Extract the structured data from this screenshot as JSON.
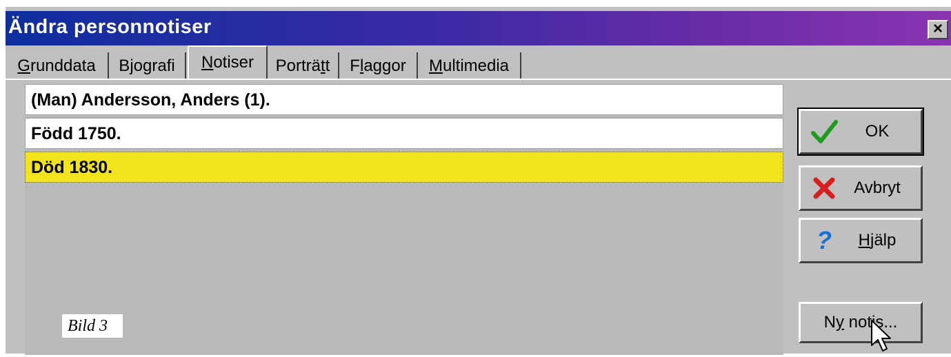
{
  "window": {
    "title": "Ändra personnotiser",
    "close_glyph": "×"
  },
  "tabs": [
    {
      "label_ul": "G",
      "label_rest": "runddata"
    },
    {
      "label_pre": "B",
      "label_ul": "j",
      "label_rest": "ografi"
    },
    {
      "label_ul": "N",
      "label_rest": "otiser"
    },
    {
      "label_pre": "Port",
      "label_mid": "rä",
      "label_ul": "t",
      "label_rest": "t"
    },
    {
      "label_pre": "F",
      "label_ul": "l",
      "label_rest": "aggor"
    },
    {
      "label_ul": "M",
      "label_rest": "ultimedia"
    }
  ],
  "notes_list": [
    "(Man) Andersson, Anders (1).",
    "Född 1750.",
    "Död 1830."
  ],
  "caption": "Bild 3",
  "buttons": {
    "ok": {
      "label": "OK",
      "icon": "checkmark-icon",
      "icon_color": "#1f9b1f"
    },
    "cancel": {
      "label": "Avbryt",
      "icon": "cross-icon",
      "icon_color": "#d81e1e"
    },
    "help": {
      "label_ul": "H",
      "label_rest": "jälp",
      "icon": "question-icon",
      "icon_color": "#1a6fd6"
    },
    "new_note": {
      "label_pre": "N",
      "label_ul": "y",
      "label_rest": " notis..."
    }
  },
  "colors": {
    "titlebar_start": "#0e2f9e",
    "titlebar_end": "#8a35b0",
    "selected_row": "#f2e31a",
    "dialog_bg": "#c0c0c0"
  }
}
